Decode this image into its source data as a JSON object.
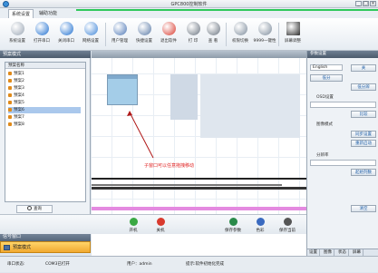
{
  "window": {
    "title": "GPC800控制软件",
    "min": "_",
    "max": "□",
    "close": "×"
  },
  "tabs": [
    "系统设置",
    "辅助功能"
  ],
  "toolbar": [
    {
      "label": "系统设置",
      "color": "#9aa6b4"
    },
    {
      "label": "打开串口",
      "color": "#1e6fd0"
    },
    {
      "label": "关闭串口",
      "color": "#1e6fd0"
    },
    {
      "label": "网络设置",
      "color": "#3f86d8"
    },
    {
      "label": "用户管理",
      "color": "#4e78b6"
    },
    {
      "label": "快捷设置",
      "color": "#5a7aa6"
    },
    {
      "label": "退出软件",
      "color": "#d93a2e"
    },
    {
      "label": "打 印",
      "color": "#6a7480"
    },
    {
      "label": "查 看",
      "color": "#6a7480"
    },
    {
      "label": "权限切换",
      "color": "#7d8c9c"
    },
    {
      "label": "9999一键性",
      "color": "#7d8c9c"
    },
    {
      "label": "屏幕调整",
      "color": "#2b2b2b"
    }
  ],
  "left_panel": {
    "title": "预案模式",
    "column_header": "预案名称",
    "items": [
      "预案1",
      "预案2",
      "预案3",
      "预案4",
      "预案5",
      "预案6",
      "预案7",
      "预案8"
    ],
    "selected_index": 5,
    "query_button": "查询"
  },
  "main": {
    "annotation": "子窗口可以任意拖拽移动"
  },
  "bottom_left": {
    "signal_window": "信号窗口",
    "preset_mode": "预案模式"
  },
  "action_bar": [
    {
      "label": "开机",
      "color": "#3aa843"
    },
    {
      "label": "关机",
      "color": "#d93a2e"
    },
    {
      "label": "保存参数",
      "color": "#2a8a4a"
    },
    {
      "label": "色彩",
      "color": "#3a6ac0"
    },
    {
      "label": "保存当前",
      "color": "#555555"
    }
  ],
  "right_panel": {
    "title": "参数设置",
    "language": "English",
    "close_label": "关",
    "buttons": [
      "低分",
      "低分辨",
      "比较",
      "同步设置",
      "重新启动",
      "起始列数",
      "清空"
    ],
    "labels": [
      "OSD设置",
      "图像模式",
      "分辨率"
    ],
    "tabs": [
      "设置",
      "图像",
      "状态",
      "屏幕"
    ]
  },
  "status": {
    "serial_label": "串口状态:",
    "serial_value": "COM3已打开",
    "user": "用户：admin",
    "message": "提示:软件初始化完成"
  }
}
